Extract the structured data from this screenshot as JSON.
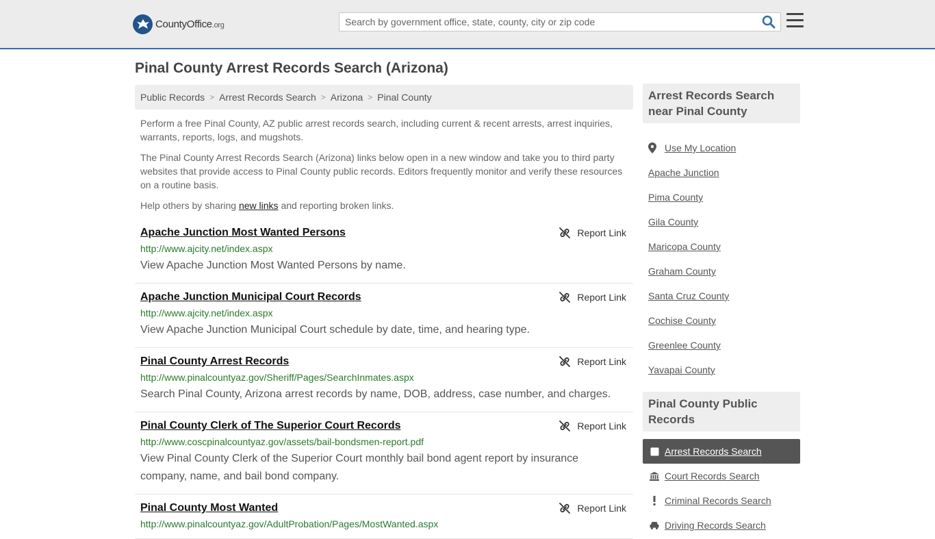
{
  "header": {
    "logo_text": "CountyOffice",
    "logo_tld": ".org",
    "search_placeholder": "Search by government office, state, county, city or zip code"
  },
  "page_title": "Pinal County Arrest Records Search (Arizona)",
  "breadcrumb": [
    "Public Records",
    "Arrest Records Search",
    "Arizona",
    "Pinal County"
  ],
  "intro": {
    "p1": "Perform a free Pinal County, AZ public arrest records search, including current & recent arrests, arrest inquiries, warrants, reports, logs, and mugshots.",
    "p2": "The Pinal County Arrest Records Search (Arizona) links below open in a new window and take you to third party websites that provide access to Pinal County public records. Editors frequently monitor and verify these resources on a routine basis.",
    "p3_before": "Help others by sharing ",
    "p3_link": "new links",
    "p3_after": " and reporting broken links."
  },
  "report_label": "Report Link",
  "records": [
    {
      "title": "Apache Junction Most Wanted Persons",
      "url": "http://www.ajcity.net/index.aspx",
      "desc": "View Apache Junction Most Wanted Persons by name."
    },
    {
      "title": "Apache Junction Municipal Court Records",
      "url": "http://www.ajcity.net/index.aspx",
      "desc": "View Apache Junction Municipal Court schedule by date, time, and hearing type."
    },
    {
      "title": "Pinal County Arrest Records",
      "url": "http://www.pinalcountyaz.gov/Sheriff/Pages/SearchInmates.aspx",
      "desc": "Search Pinal County, Arizona arrest records by name, DOB, address, case number, and charges."
    },
    {
      "title": "Pinal County Clerk of The Superior Court Records",
      "url": "http://www.coscpinalcountyaz.gov/assets/bail-bondsmen-report.pdf",
      "desc": "View Pinal County Clerk of the Superior Court monthly bail bond agent report by insurance company, name, and bail bond company."
    },
    {
      "title": "Pinal County Most Wanted",
      "url": "http://www.pinalcountyaz.gov/AdultProbation/Pages/MostWanted.aspx",
      "desc": ""
    }
  ],
  "sidebar": {
    "near_heading": "Arrest Records Search near Pinal County",
    "use_location": "Use My Location",
    "near": [
      "Apache Junction",
      "Pima County",
      "Gila County",
      "Maricopa County",
      "Graham County",
      "Santa Cruz County",
      "Cochise County",
      "Greenlee County",
      "Yavapai County"
    ],
    "public_heading": "Pinal County Public Records",
    "public_records": [
      {
        "label": "Arrest Records Search",
        "icon": "square-icon"
      },
      {
        "label": "Court Records Search",
        "icon": "courthouse-icon"
      },
      {
        "label": "Criminal Records Search",
        "icon": "exclamation-icon"
      },
      {
        "label": "Driving Records Search",
        "icon": "car-icon"
      }
    ]
  },
  "colors": {
    "accent": "#2f6fb0",
    "url_green": "#2a7a2e",
    "active_bg": "#555555"
  }
}
